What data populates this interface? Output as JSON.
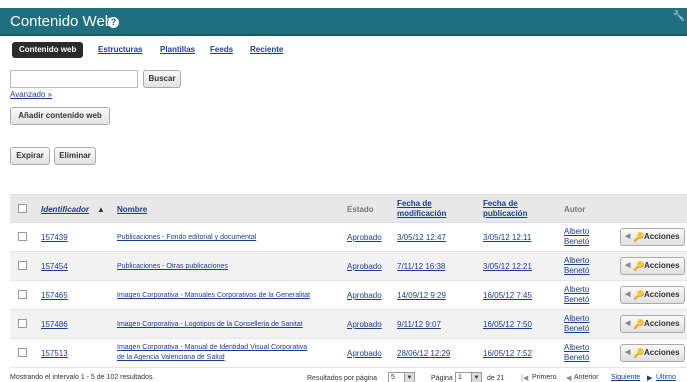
{
  "header": {
    "title": "Contenido Web"
  },
  "tabs": [
    {
      "label": "Contenido web"
    },
    {
      "label": "Estructuras"
    },
    {
      "label": "Plantillas"
    },
    {
      "label": "Feeds"
    },
    {
      "label": "Reciente"
    }
  ],
  "search": {
    "placeholder": "",
    "button_label": "Buscar",
    "advanced_label": "Avanzado »"
  },
  "toolbar": {
    "add_label": "Añadir contenido web",
    "expire_label": "Expirar",
    "delete_label": "Eliminar"
  },
  "table": {
    "columns": {
      "id": "Identificador",
      "sort_indicator": "▲",
      "name": "Nombre",
      "status": "Estado",
      "modified_line1": "Fecha de",
      "modified_line2": "modificación",
      "published_line1": "Fecha de",
      "published_line2": "publicación",
      "author": "Autor"
    },
    "rows": [
      {
        "id": "157439",
        "name1": "Publicaciones - Fondo editorial y documental",
        "name2": "",
        "status": "Aprobado",
        "modified": "3/05/12 12:47",
        "published": "3/05/12 12:11",
        "author1": "Alberto",
        "author2": "Benetó",
        "action": "Acciones"
      },
      {
        "id": "157454",
        "name1": "Publicaciones - Otras publicaciones",
        "name2": "",
        "status": "Aprobado",
        "modified": "7/11/12 16:38",
        "published": "3/05/12 12:21",
        "author1": "Alberto",
        "author2": "Benetó",
        "action": "Acciones"
      },
      {
        "id": "157465",
        "name1": "Imagen Corporativa - Manuales Corporativos de la Generalitat",
        "name2": "",
        "status": "Aprobado",
        "modified": "14/09/12 9:29",
        "published": "16/05/12 7:45",
        "author1": "Alberto",
        "author2": "Benetó",
        "action": "Acciones"
      },
      {
        "id": "157486",
        "name1": "Imagen Corporativa - Logotipos de la Conselleria de Sanitat",
        "name2": "",
        "status": "Aprobado",
        "modified": "9/11/12 9:07",
        "published": "16/05/12 7:50",
        "author1": "Alberto",
        "author2": "Benetó",
        "action": "Acciones"
      },
      {
        "id": "157513",
        "name1": "Imagen Corporativa - Manual de Identidad Visual Corporativa",
        "name2": "de la Agencia Valenciana de Salud",
        "status": "Aprobado",
        "modified": "28/06/12 12:29",
        "published": "16/05/12 7:52",
        "author1": "Alberto",
        "author2": "Benetó",
        "action": "Acciones"
      }
    ]
  },
  "footer": {
    "range_text": "Mostrando el intervalo 1 - 5 de 102 resultados.",
    "per_page_label": "Resultados por página",
    "per_page_value": "5",
    "page_label": "Página",
    "page_value": "1",
    "page_total": "de 21",
    "first": "Primero",
    "prev": "Anterior",
    "next": "Siguiente",
    "last": "Último"
  }
}
